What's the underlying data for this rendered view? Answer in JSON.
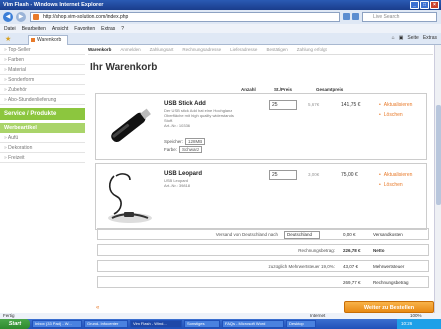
{
  "window": {
    "title": "Vim Flash - Windows Internet Explorer"
  },
  "address": {
    "url": "http://shop.vim-solution.com/index.php",
    "search_placeholder": "Live Search"
  },
  "menu": [
    "Datei",
    "Bearbeiten",
    "Ansicht",
    "Favoriten",
    "Extras",
    "?"
  ],
  "tab": {
    "label": "Warenkorb"
  },
  "toolbar_right": [
    "Seite",
    "Extras"
  ],
  "sidebar": {
    "items": [
      "Top-Seller",
      "Farben",
      "Material",
      "Sonderform",
      "Zubehör",
      "Abo-Stundenlieferung"
    ],
    "section": "Service / Produkte",
    "highlight": "Werbeartikel",
    "items2": [
      "Aufü",
      "Dekoration",
      "Freizeit"
    ]
  },
  "steps": [
    "Warenkorb",
    "Anmelden",
    "Zahlungsart",
    "Rechnungsadresse",
    "Lieferadresse",
    "Bestätigen",
    "Zahlung erfolgt"
  ],
  "page": {
    "heading": "Ihr Warenkorb"
  },
  "columns": {
    "qty": "Anzahl",
    "unit": "St./Preis",
    "total": "Gesamtpreis"
  },
  "cart": [
    {
      "name": "USB Stick Add",
      "desc": "Der USB stick Add hat eine Hochglanz Oberfläche mit high quality widerstands Stoff.",
      "artnr": "Art.-Nr.: 10336",
      "opt1_label": "Speicher:",
      "opt1_value": "128MB",
      "opt2_label": "Farbe:",
      "opt2_value": "Schwarz",
      "qty": "25",
      "unit": "5,67€",
      "total": "141,75 €",
      "action1": "Aktualisieren",
      "action2": "Löschen"
    },
    {
      "name": "USB Leopard",
      "desc": "USB Leopard",
      "artnr": "Art.-Nr.: 39818",
      "qty": "25",
      "unit": "3,00€",
      "total": "75,00 €",
      "action1": "Aktualisieren",
      "action2": "Löschen"
    }
  ],
  "summary": [
    {
      "label": "Versand von Deutschland nach",
      "country": "Deutschland",
      "value": "0,00 €",
      "note": "Versandkosten"
    },
    {
      "label": "Rechnungsbetrag:",
      "value": "226,78 €",
      "note": "Netto"
    },
    {
      "label": "zuzüglich Mehrwertsteuer 19,0%:",
      "value": "43,07 €",
      "note": "Mehrwertsteuer"
    },
    {
      "label": "",
      "value": "269,77 €",
      "note": "Rechnungsbetrag"
    }
  ],
  "buttons": {
    "back": "«",
    "checkout": "Weiter zu Bestellen"
  },
  "status": {
    "left": "Fertig",
    "zone": "Internet",
    "zoom": "100%"
  },
  "taskbar": {
    "start": "Start",
    "tasks": [
      "Inbox (33 Pad) - W...",
      "Grund- Infocenter",
      "Vim Flash - Wind...",
      "Sonstiges",
      "FAQs - Microsoft Word",
      "Desktop"
    ],
    "clock": "10:26"
  }
}
